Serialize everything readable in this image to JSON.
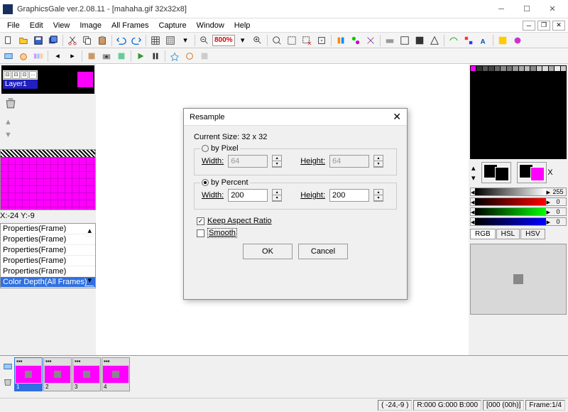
{
  "title": "GraphicsGale ver.2.08.11 - [mahaha.gif 32x32x8]",
  "menu": [
    "File",
    "Edit",
    "View",
    "Image",
    "All Frames",
    "Capture",
    "Window",
    "Help"
  ],
  "zoom": "800%",
  "layer": {
    "name": "Layer1"
  },
  "coords": "X:-24 Y:-9",
  "history": [
    "Properties(Frame)",
    "Properties(Frame)",
    "Properties(Frame)",
    "Properties(Frame)",
    "Properties(Frame)",
    "Color Depth(All Frames)"
  ],
  "palette_first": [
    "#ff00ff",
    "#333",
    "#555",
    "#444",
    "#666",
    "#888",
    "#777",
    "#999",
    "#aaa",
    "#bbb",
    "#888",
    "#ccc",
    "#ddd",
    "#aaa",
    "#eee",
    "#ccc"
  ],
  "gradient_max": "255",
  "rgb_vals": [
    "0",
    "0",
    "0"
  ],
  "tabs": [
    "RGB",
    "HSL",
    "HSV"
  ],
  "frames": [
    "1",
    "2",
    "3",
    "4"
  ],
  "status": {
    "pos": "( -24,-9 )",
    "rgb": "R:000 G:000 B:000",
    "idx": "[000 (00h)]",
    "frame": "Frame:1/4"
  },
  "dialog": {
    "title": "Resample",
    "current": "Current Size: 32 x 32",
    "by_pixel": "by Pixel",
    "by_percent": "by Percent",
    "width": "Width:",
    "height": "Height:",
    "px_w": "64",
    "px_h": "64",
    "pc_w": "200",
    "pc_h": "200",
    "keep": "Keep Aspect Ratio",
    "smooth": "Smooth",
    "ok": "OK",
    "cancel": "Cancel"
  }
}
